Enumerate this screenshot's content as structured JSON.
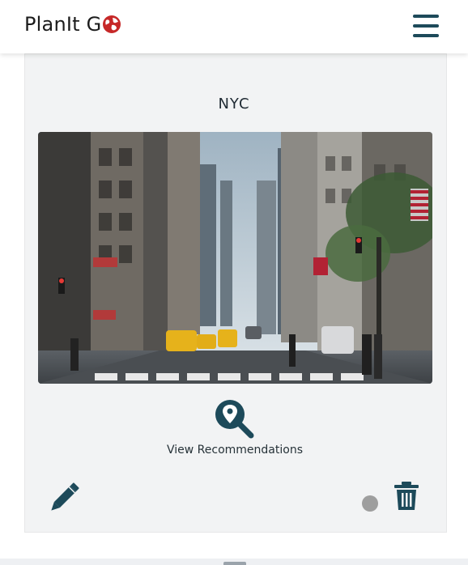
{
  "header": {
    "brand_text": "PlanIt G",
    "brand_suffix_icon": "globe-icon",
    "menu_icon": "hamburger-menu-icon"
  },
  "card": {
    "title": "NYC",
    "image_alt": "NYC street photo",
    "recommendations_label": "View Recommendations",
    "recommendations_icon": "search-location-icon",
    "edit_icon": "pencil-icon",
    "delete_icon": "trash-icon",
    "status_dot_color": "#9e9e9e"
  },
  "colors": {
    "accent": "#1d4a5a",
    "brand_red": "#c62828",
    "card_bg": "#f2f3f4"
  }
}
